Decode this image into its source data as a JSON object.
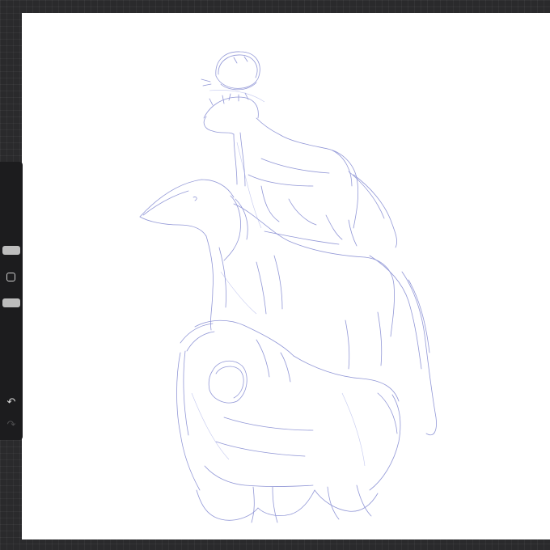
{
  "app": {
    "accent_stroke_color": "#7f86d0",
    "background_color": "#2a2a2c",
    "canvas_color": "#ffffff"
  },
  "sidebar": {
    "brush_size_slider": {
      "icon": "slider-thumb"
    },
    "modify_button": {
      "icon": "square-outline-icon"
    },
    "opacity_slider": {
      "icon": "slider-thumb"
    },
    "undo_button": {
      "icon": "undo-icon",
      "glyph": "↶"
    },
    "redo_button": {
      "icon": "redo-icon",
      "glyph": "↷",
      "enabled": false
    }
  },
  "canvas": {
    "drawing": {
      "subject": "sketch",
      "stroke_color": "#7f86d0"
    }
  }
}
